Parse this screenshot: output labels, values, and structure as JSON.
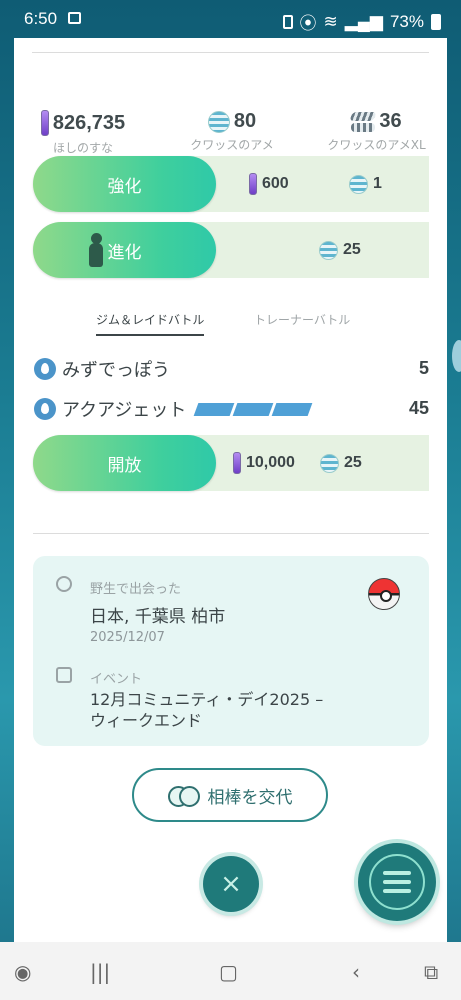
{
  "status_bar": {
    "time": "6:50",
    "battery": "73%"
  },
  "resources": [
    {
      "value": "826,735",
      "label": "ほしのすな",
      "icon": "stardust-icon"
    },
    {
      "value": "80",
      "label": "クワッスのアメ",
      "icon": "candy-icon"
    },
    {
      "value": "36",
      "label": "クワッスのアメXL",
      "icon": "candy-xl-icon"
    }
  ],
  "power_up": {
    "label": "強化",
    "stardust_cost": "600",
    "candy_cost": "1"
  },
  "evolve": {
    "label": "進化",
    "candy_cost": "25"
  },
  "tabs": [
    {
      "label": "ジム＆レイドバトル",
      "active": true
    },
    {
      "label": "トレーナーバトル",
      "active": false
    }
  ],
  "moves": [
    {
      "name": "みずでっぽう",
      "power": "5",
      "type": "water",
      "energy_bars": 0
    },
    {
      "name": "アクアジェット",
      "power": "45",
      "type": "water",
      "energy_bars": 3
    }
  ],
  "unlock": {
    "label": "開放",
    "stardust_cost": "10,000",
    "candy_cost": "25"
  },
  "info_card": {
    "catch_label": "野生で出会った",
    "location": "日本, 千葉県 柏市",
    "date": "2025/12/07",
    "event_label": "イベント",
    "event_name_line1": "12月コミュニティ・デイ2025 –",
    "event_name_line2": "ウィークエンド"
  },
  "buddy_button": {
    "label": "相棒を交代"
  },
  "colors": {
    "accent": "#3fcf9d",
    "teal": "#1f7a7a",
    "water": "#4b94c9"
  }
}
